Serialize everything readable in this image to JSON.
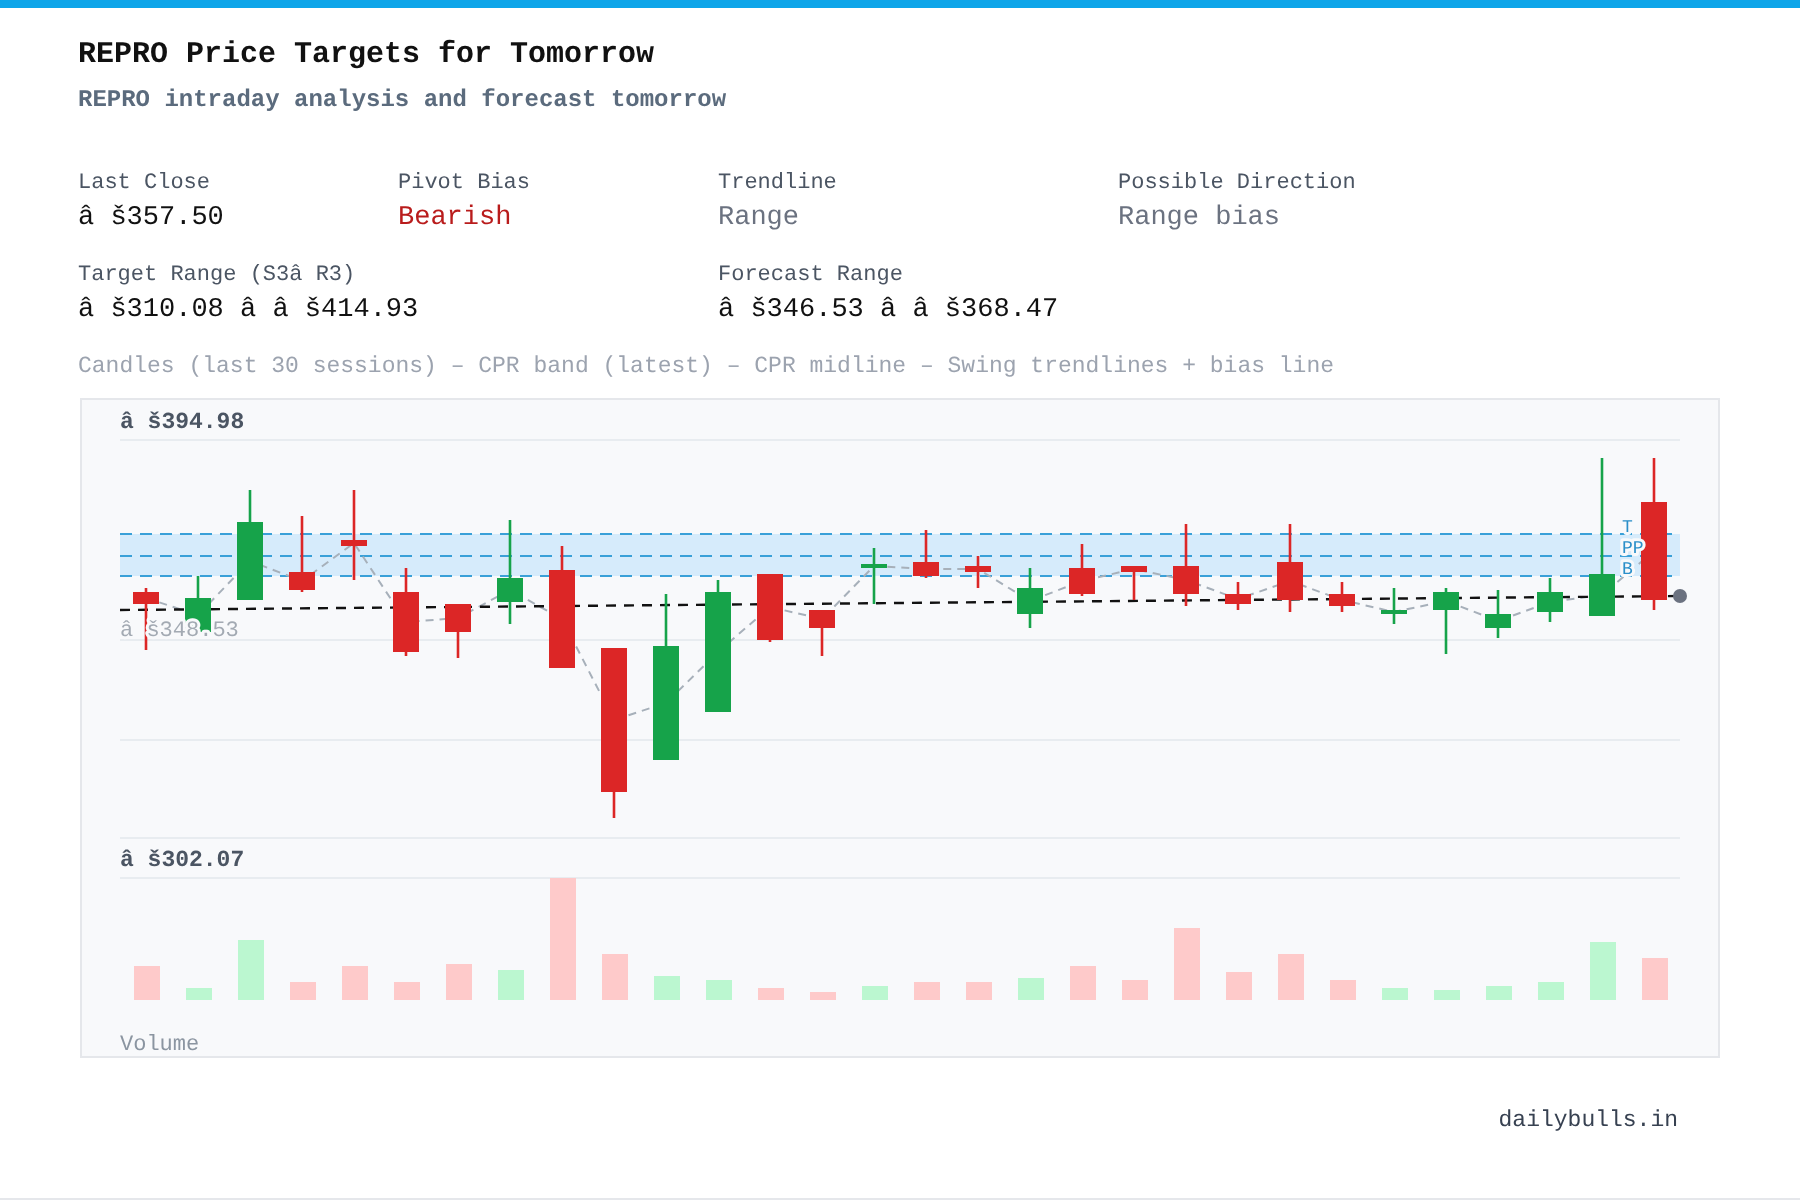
{
  "title": "REPRO Price Targets for Tomorrow",
  "subtitle": "REPRO intraday analysis and forecast tomorrow",
  "stats": [
    {
      "label": "Last Close",
      "value": "â š357.50",
      "kind": "price"
    },
    {
      "label": "Pivot Bias",
      "value": "Bearish",
      "kind": "bearish"
    },
    {
      "label": "Trendline",
      "value": "Range",
      "kind": "neutral"
    },
    {
      "label": "Possible Direction",
      "value": "Range bias",
      "kind": "neutral"
    },
    {
      "label": "Target Range (S3â  R3)",
      "value": "â š310.08 â    â š414.93",
      "kind": "price"
    },
    {
      "label": "Forecast Range",
      "value": "â š346.53 â    â š368.47",
      "kind": "price"
    }
  ],
  "caption": "Candles (last 30 sessions) – CPR band (latest) – CPR midline – Swing trendlines + bias line",
  "chart": {
    "top_label": "â š394.98",
    "midline_label": "â š348.53",
    "cpr_labels": [
      "T",
      "PP",
      "B"
    ],
    "volume_top_label": "â š302.07",
    "volume_label": "Volume"
  },
  "footer": "dailybulls.in"
}
